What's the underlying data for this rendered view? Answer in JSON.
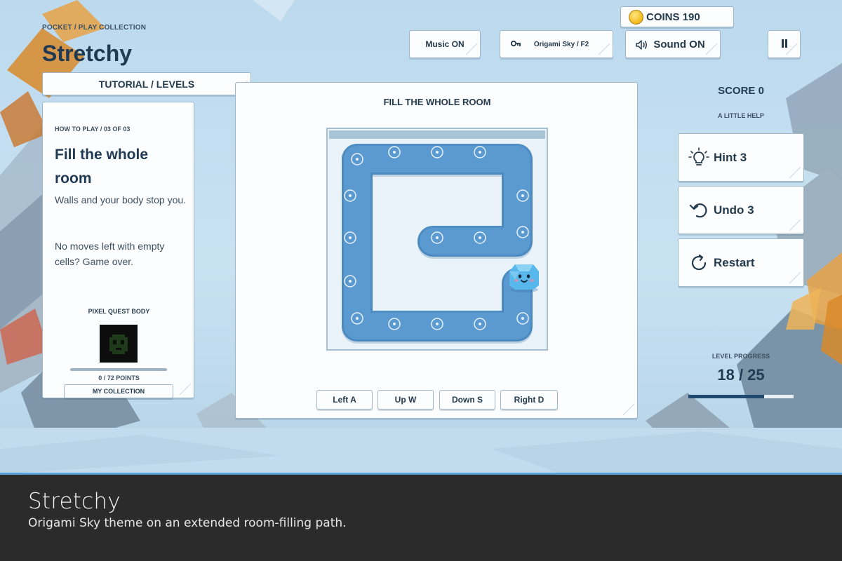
{
  "header": {
    "breadcrumb": "POCKET / PLAY COLLECTION",
    "title": "Stretchy",
    "tabs_label": "TUTORIAL / LEVELS"
  },
  "toolbar": {
    "music_label": "Music ON",
    "theme_label": "Origami Sky / F2",
    "sound_label": "Sound ON",
    "pause_icon": "pause-icon",
    "coins_label": "COINS 190"
  },
  "howto": {
    "crumb": "HOW TO PLAY / 03 OF 03",
    "title": "Fill the whole room",
    "p1": "Walls and your body stop you.",
    "p2": "No moves left with empty cells? Game over.",
    "body_label": "PIXEL QUEST BODY",
    "points": "0 / 72 POINTS",
    "points_fraction": 0,
    "collection_button": "MY COLLECTION"
  },
  "board": {
    "title": "FILL THE WHOLE ROOM",
    "controls": [
      "Left A",
      "Up W",
      "Down S",
      "Right D"
    ]
  },
  "sidebar": {
    "score": "SCORE 0",
    "help_label": "A LITTLE HELP",
    "hint": "Hint 3",
    "undo": "Undo 3",
    "restart": "Restart",
    "progress_label": "LEVEL PROGRESS",
    "progress_text": "18 / 25",
    "progress_fraction": 0.72
  },
  "caption": {
    "title": "Stretchy",
    "subtitle": "Origami Sky theme on an extended room-filling path."
  },
  "colors": {
    "path": "#4f8fc6",
    "path_dark": "#3e79ad",
    "accent": "#1f4a6e",
    "card_border": "#9fb7c8"
  }
}
